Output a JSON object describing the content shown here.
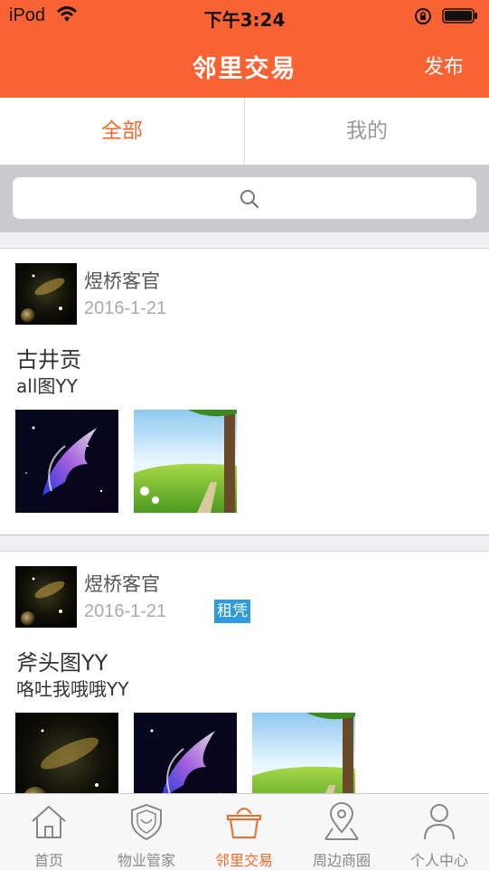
{
  "status": {
    "carrier": "iPod",
    "time": "下午3:24"
  },
  "nav": {
    "title": "邻里交易",
    "publish": "发布"
  },
  "tabs": {
    "all": "全部",
    "mine": "我的",
    "selected": "all"
  },
  "search": {
    "icon": "search-icon"
  },
  "posts": [
    {
      "user": "煜桥客官",
      "date": "2016-1-21",
      "badge": "",
      "title": "古井贡",
      "desc": "all图YY",
      "images": [
        "galaxy-wing",
        "green-meadow"
      ]
    },
    {
      "user": "煜桥客官",
      "date": "2016-1-21",
      "badge": "租凭",
      "title": "斧头图YY",
      "desc": "咯吐我哦哦YY",
      "images": [
        "space-planet",
        "galaxy-wing",
        "green-meadow"
      ]
    }
  ],
  "tabbar": {
    "items": [
      {
        "label": "首页",
        "icon": "home-icon"
      },
      {
        "label": "物业管家",
        "icon": "shield-icon"
      },
      {
        "label": "邻里交易",
        "icon": "basket-icon"
      },
      {
        "label": "周边商圈",
        "icon": "location-pin-icon"
      },
      {
        "label": "个人中心",
        "icon": "person-icon"
      }
    ],
    "active_index": 2
  },
  "colors": {
    "accent": "#f96232",
    "tab_active": "#f26a2a",
    "badge": "#2e9be0"
  }
}
